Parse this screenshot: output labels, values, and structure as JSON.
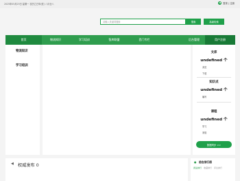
{
  "topbar": {
    "date": "2025年05月25日 星期一 农历乙巳年(蛇) 八月廿八",
    "login_label": "登录 | 注册"
  },
  "search": {
    "placeholder": "请输入关键词搜索",
    "button_label": "搜索",
    "advanced_label": "高级检索"
  },
  "nav": {
    "items": [
      {
        "label": "首页"
      },
      {
        "label": "物流知识"
      },
      {
        "label": "学习培训"
      },
      {
        "label": "智库联盟"
      },
      {
        "label": "西门专栏"
      },
      {
        "label": "后台管理"
      },
      {
        "label": "用户注册"
      }
    ]
  },
  "left": {
    "categories": [
      "物流知识",
      "学习培训"
    ]
  },
  "stats": {
    "library": {
      "title": "文库",
      "value": "undefined 个",
      "subs": [
        "浏览",
        "下载"
      ]
    },
    "knowledge": {
      "title": "知识点",
      "value": "undefined 个",
      "subs": [
        "编写"
      ]
    },
    "courses": {
      "title": "课程",
      "value": "undefined 个",
      "subs": [
        "学习",
        "测验"
      ]
    },
    "sync_label": "数据同步 >>"
  },
  "announcement": {
    "title": "权威发布",
    "count": "0"
  },
  "ranking": {
    "title": "综合排行榜",
    "tabs": [
      "阅读排行",
      "收藏排行",
      "评论排行"
    ]
  },
  "colors": {
    "brand_green": "#1fa04a",
    "nav_green": "#2f9d4e"
  }
}
